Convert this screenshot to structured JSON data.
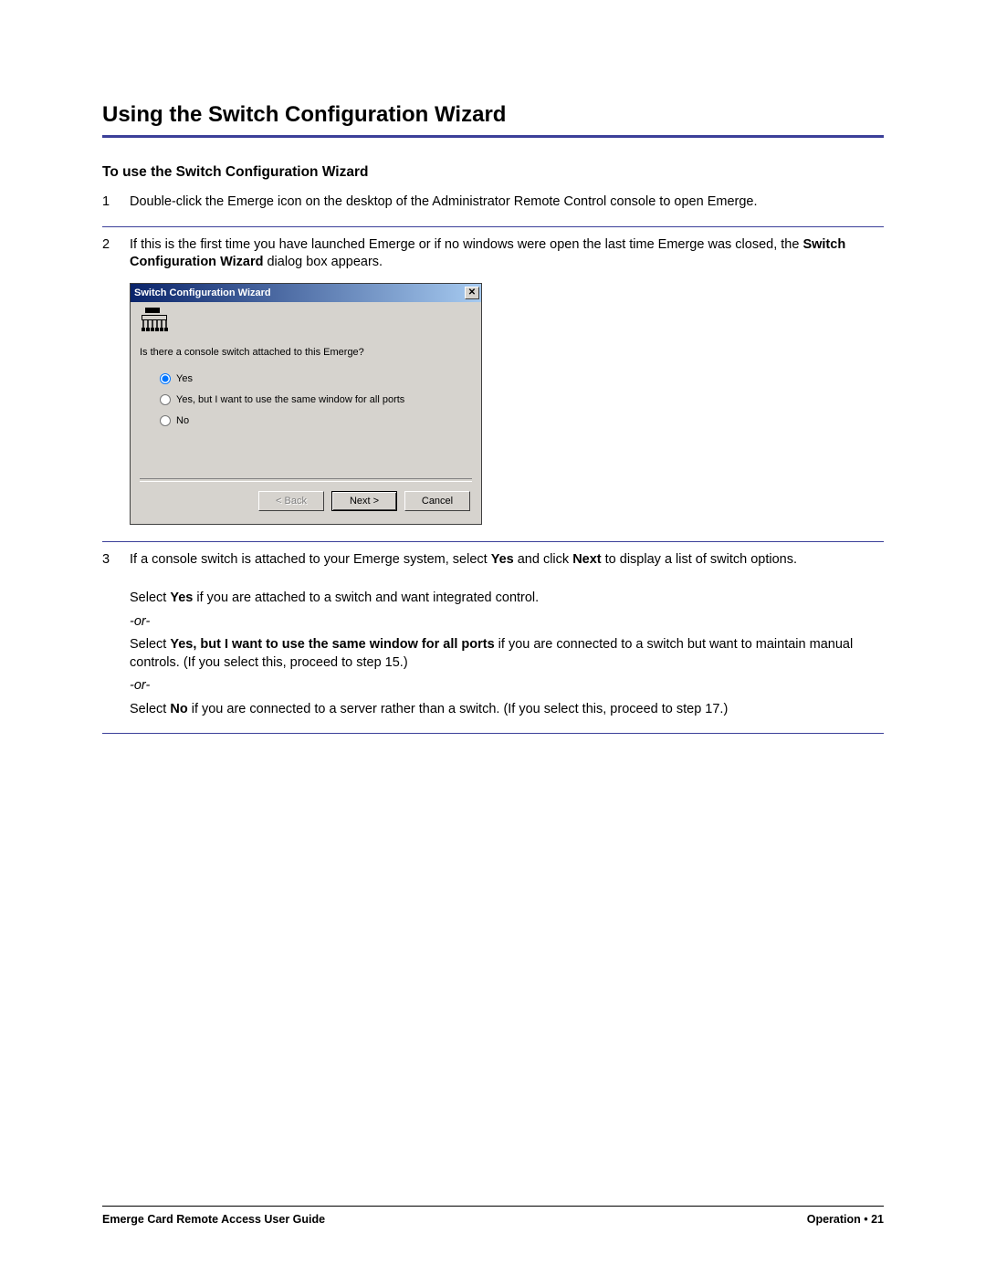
{
  "page_title": "Using the Switch Configuration Wizard",
  "section_title": "To use the Switch Configuration Wizard",
  "steps": [
    {
      "num": "1",
      "text": "Double-click the Emerge icon on the desktop of the Administrator Remote Control console to open Emerge."
    },
    {
      "num": "2",
      "text_pre": "If this is the first time you have launched Emerge or if no windows were open the last time Emerge was closed, the ",
      "text_bold": "Switch Configuration Wizard",
      "text_post": " dialog box appears."
    },
    {
      "num": "3",
      "line1_pre": "If a console switch is attached to your Emerge system, select ",
      "line1_b1": "Yes",
      "line1_mid": " and click ",
      "line1_b2": "Next",
      "line1_post": " to display a list of switch options.",
      "l2_pre": "Select ",
      "l2_b": "Yes",
      "l2_post": " if you are attached to a switch and want integrated control.",
      "or": "-or-",
      "l3_pre": "Select ",
      "l3_b": "Yes, but I want to use the same window for all ports",
      "l3_post": " if you are connected to a switch but want to maintain manual controls. (If you select this, proceed to step 15.)",
      "l4_pre": "Select ",
      "l4_b": "No",
      "l4_post": " if you are connected to a server rather than a switch. (If you select this, proceed to step 17.)"
    }
  ],
  "dialog": {
    "title": "Switch Configuration Wizard",
    "close": "✕",
    "question": "Is there a console switch attached to this Emerge?",
    "options": [
      {
        "label": "Yes",
        "checked": true
      },
      {
        "label": "Yes, but I want to use the same window for all ports",
        "checked": false
      },
      {
        "label": "No",
        "checked": false
      }
    ],
    "buttons": {
      "back": "< Back",
      "next": "Next >",
      "cancel": "Cancel"
    }
  },
  "footer": {
    "left": "Emerge Card Remote Access User Guide",
    "right_section": "Operation",
    "right_bullet": " • ",
    "right_page": "21"
  }
}
